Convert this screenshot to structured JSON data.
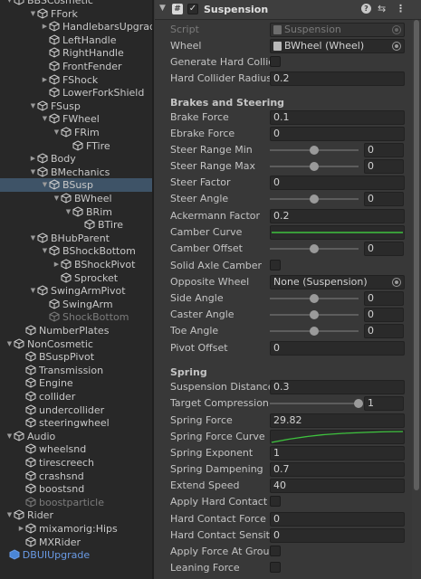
{
  "hierarchy": {
    "rows": [
      {
        "label": "BBSCosmetic",
        "depth": 0,
        "arrow": "down",
        "selected": false,
        "dim": false,
        "blue": false
      },
      {
        "label": "FFork",
        "depth": 2,
        "arrow": "down",
        "selected": false,
        "dim": false,
        "blue": false
      },
      {
        "label": "HandlebarsUpgrade",
        "depth": 3,
        "arrow": "right",
        "selected": false,
        "dim": false,
        "blue": false
      },
      {
        "label": "LeftHandle",
        "depth": 3,
        "arrow": "",
        "selected": false,
        "dim": false,
        "blue": false
      },
      {
        "label": "RightHandle",
        "depth": 3,
        "arrow": "",
        "selected": false,
        "dim": false,
        "blue": false
      },
      {
        "label": "FrontFender",
        "depth": 3,
        "arrow": "",
        "selected": false,
        "dim": false,
        "blue": false
      },
      {
        "label": "FShock",
        "depth": 3,
        "arrow": "right",
        "selected": false,
        "dim": false,
        "blue": false
      },
      {
        "label": "LowerForkShield",
        "depth": 3,
        "arrow": "",
        "selected": false,
        "dim": false,
        "blue": false
      },
      {
        "label": "FSusp",
        "depth": 2,
        "arrow": "down",
        "selected": false,
        "dim": false,
        "blue": false
      },
      {
        "label": "FWheel",
        "depth": 3,
        "arrow": "down",
        "selected": false,
        "dim": false,
        "blue": false
      },
      {
        "label": "FRim",
        "depth": 4,
        "arrow": "down",
        "selected": false,
        "dim": false,
        "blue": false
      },
      {
        "label": "FTire",
        "depth": 5,
        "arrow": "",
        "selected": false,
        "dim": false,
        "blue": false
      },
      {
        "label": "Body",
        "depth": 2,
        "arrow": "right",
        "selected": false,
        "dim": false,
        "blue": false
      },
      {
        "label": "BMechanics",
        "depth": 2,
        "arrow": "down",
        "selected": false,
        "dim": false,
        "blue": false
      },
      {
        "label": "BSusp",
        "depth": 3,
        "arrow": "down",
        "selected": true,
        "dim": false,
        "blue": false
      },
      {
        "label": "BWheel",
        "depth": 4,
        "arrow": "down",
        "selected": false,
        "dim": false,
        "blue": false
      },
      {
        "label": "BRim",
        "depth": 5,
        "arrow": "down",
        "selected": false,
        "dim": false,
        "blue": false
      },
      {
        "label": "BTire",
        "depth": 6,
        "arrow": "",
        "selected": false,
        "dim": false,
        "blue": false
      },
      {
        "label": "BHubParent",
        "depth": 2,
        "arrow": "down",
        "selected": false,
        "dim": false,
        "blue": false
      },
      {
        "label": "BShockBottom",
        "depth": 3,
        "arrow": "down",
        "selected": false,
        "dim": false,
        "blue": false
      },
      {
        "label": "BShockPivot",
        "depth": 4,
        "arrow": "right",
        "selected": false,
        "dim": false,
        "blue": false
      },
      {
        "label": "Sprocket",
        "depth": 4,
        "arrow": "",
        "selected": false,
        "dim": false,
        "blue": false
      },
      {
        "label": "SwingArmPivot",
        "depth": 2,
        "arrow": "down",
        "selected": false,
        "dim": false,
        "blue": false
      },
      {
        "label": "SwingArm",
        "depth": 3,
        "arrow": "",
        "selected": false,
        "dim": false,
        "blue": false
      },
      {
        "label": "ShockBottom",
        "depth": 3,
        "arrow": "",
        "selected": false,
        "dim": true,
        "blue": false
      },
      {
        "label": "NumberPlates",
        "depth": 1,
        "arrow": "",
        "selected": false,
        "dim": false,
        "blue": false
      },
      {
        "label": "NonCosmetic",
        "depth": 0,
        "arrow": "down",
        "selected": false,
        "dim": false,
        "blue": false
      },
      {
        "label": "BSuspPivot",
        "depth": 1,
        "arrow": "",
        "selected": false,
        "dim": false,
        "blue": false
      },
      {
        "label": "Transmission",
        "depth": 1,
        "arrow": "",
        "selected": false,
        "dim": false,
        "blue": false
      },
      {
        "label": "Engine",
        "depth": 1,
        "arrow": "",
        "selected": false,
        "dim": false,
        "blue": false
      },
      {
        "label": "collider",
        "depth": 1,
        "arrow": "",
        "selected": false,
        "dim": false,
        "blue": false
      },
      {
        "label": "undercollider",
        "depth": 1,
        "arrow": "",
        "selected": false,
        "dim": false,
        "blue": false
      },
      {
        "label": "steeringwheel",
        "depth": 1,
        "arrow": "",
        "selected": false,
        "dim": false,
        "blue": false
      },
      {
        "label": "Audio",
        "depth": 0,
        "arrow": "down",
        "selected": false,
        "dim": false,
        "blue": false
      },
      {
        "label": "wheelsnd",
        "depth": 1,
        "arrow": "",
        "selected": false,
        "dim": false,
        "blue": false
      },
      {
        "label": "tirescreech",
        "depth": 1,
        "arrow": "",
        "selected": false,
        "dim": false,
        "blue": false
      },
      {
        "label": "crashsnd",
        "depth": 1,
        "arrow": "",
        "selected": false,
        "dim": false,
        "blue": false
      },
      {
        "label": "boostsnd",
        "depth": 1,
        "arrow": "",
        "selected": false,
        "dim": false,
        "blue": false
      },
      {
        "label": "boostparticle",
        "depth": 1,
        "arrow": "",
        "selected": false,
        "dim": true,
        "blue": false
      },
      {
        "label": "Rider",
        "depth": 0,
        "arrow": "down",
        "selected": false,
        "dim": false,
        "blue": false
      },
      {
        "label": "mixamorig:Hips",
        "depth": 1,
        "arrow": "right",
        "selected": false,
        "dim": false,
        "blue": false
      },
      {
        "label": "MXRider",
        "depth": 1,
        "arrow": "",
        "selected": false,
        "dim": false,
        "blue": false
      },
      {
        "label": "DBUIUpgrade",
        "depth": -1,
        "arrow": "",
        "selected": false,
        "dim": false,
        "blue": true
      }
    ]
  },
  "component": {
    "title": "Suspension",
    "enabled": true,
    "icon": "script-component-icon",
    "header_icons": [
      "help-icon",
      "preset-icon",
      "kebab-menu-icon"
    ]
  },
  "fields": {
    "script": {
      "label": "Script",
      "value": "Suspension"
    },
    "wheel": {
      "label": "Wheel",
      "value": "BWheel (Wheel)"
    },
    "generate_hard_collider": {
      "label": "Generate Hard Collider",
      "checked": false
    },
    "hard_collider_radius": {
      "label": "Hard Collider Radius F",
      "value": "0.2"
    },
    "brakes_section": "Brakes and Steering",
    "brake_force": {
      "label": "Brake Force",
      "value": "0.1"
    },
    "ebrake_force": {
      "label": "Ebrake Force",
      "value": "0"
    },
    "steer_range_min": {
      "label": "Steer Range Min",
      "value": "0",
      "fraction": 0.5
    },
    "steer_range_max": {
      "label": "Steer Range Max",
      "value": "0",
      "fraction": 0.5
    },
    "steer_factor": {
      "label": "Steer Factor",
      "value": "0"
    },
    "steer_angle": {
      "label": "Steer Angle",
      "value": "0",
      "fraction": 0.5
    },
    "ackermann_factor": {
      "label": "Ackermann Factor",
      "value": "0.2"
    },
    "camber_curve": {
      "label": "Camber Curve"
    },
    "camber_offset": {
      "label": "Camber Offset",
      "value": "0",
      "fraction": 0.5
    },
    "solid_axle_camber": {
      "label": "Solid Axle Camber",
      "checked": false
    },
    "opposite_wheel": {
      "label": "Opposite Wheel",
      "value": "None (Suspension)"
    },
    "side_angle": {
      "label": "Side Angle",
      "value": "0",
      "fraction": 0.5
    },
    "caster_angle": {
      "label": "Caster Angle",
      "value": "0",
      "fraction": 0.5
    },
    "toe_angle": {
      "label": "Toe Angle",
      "value": "0",
      "fraction": 0.5
    },
    "pivot_offset": {
      "label": "Pivot Offset",
      "value": "0"
    },
    "spring_section": "Spring",
    "suspension_distance": {
      "label": "Suspension Distance",
      "value": "0.3"
    },
    "target_compression": {
      "label": "Target Compression",
      "value": "1",
      "fraction": 1.0
    },
    "spring_force": {
      "label": "Spring Force",
      "value": "29.82"
    },
    "spring_force_curve": {
      "label": "Spring Force Curve"
    },
    "spring_exponent": {
      "label": "Spring Exponent",
      "value": "1"
    },
    "spring_dampening": {
      "label": "Spring Dampening",
      "value": "0.7"
    },
    "extend_speed": {
      "label": "Extend Speed",
      "value": "40"
    },
    "apply_hard_contact": {
      "label": "Apply Hard Contact Force",
      "checked": false
    },
    "hard_contact_force": {
      "label": "Hard Contact Force",
      "value": "0"
    },
    "hard_contact_sensitivity": {
      "label": "Hard Contact Sensitivity",
      "value": "0"
    },
    "apply_force_at_ground": {
      "label": "Apply Force At Ground",
      "checked": false
    },
    "leaning_force": {
      "label": "Leaning Force",
      "checked": false
    }
  },
  "colors": {
    "selection": "#3e5367",
    "curve_green": "#3ec23e",
    "prefab_blue": "#6a9be6"
  }
}
